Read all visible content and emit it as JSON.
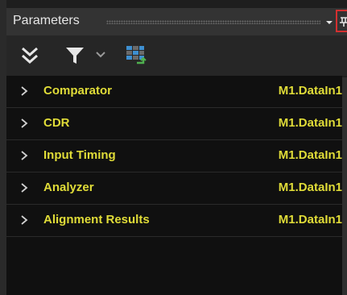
{
  "panel": {
    "title": "Parameters"
  },
  "toolbar": {
    "icons": [
      "collapse-all-icon",
      "filter-icon",
      "chevron-down-icon",
      "grid-icon"
    ]
  },
  "rows": [
    {
      "label": "Comparator",
      "value": "M1.DataIn1"
    },
    {
      "label": "CDR",
      "value": "M1.DataIn1"
    },
    {
      "label": "Input Timing",
      "value": "M1.DataIn1"
    },
    {
      "label": "Analyzer",
      "value": "M1.DataIn1"
    },
    {
      "label": "Alignment Results",
      "value": "M1.DataIn1"
    }
  ],
  "colors": {
    "accent": "#e0dc38",
    "background": "#101010",
    "header": "#333333",
    "highlight": "#d33030"
  }
}
